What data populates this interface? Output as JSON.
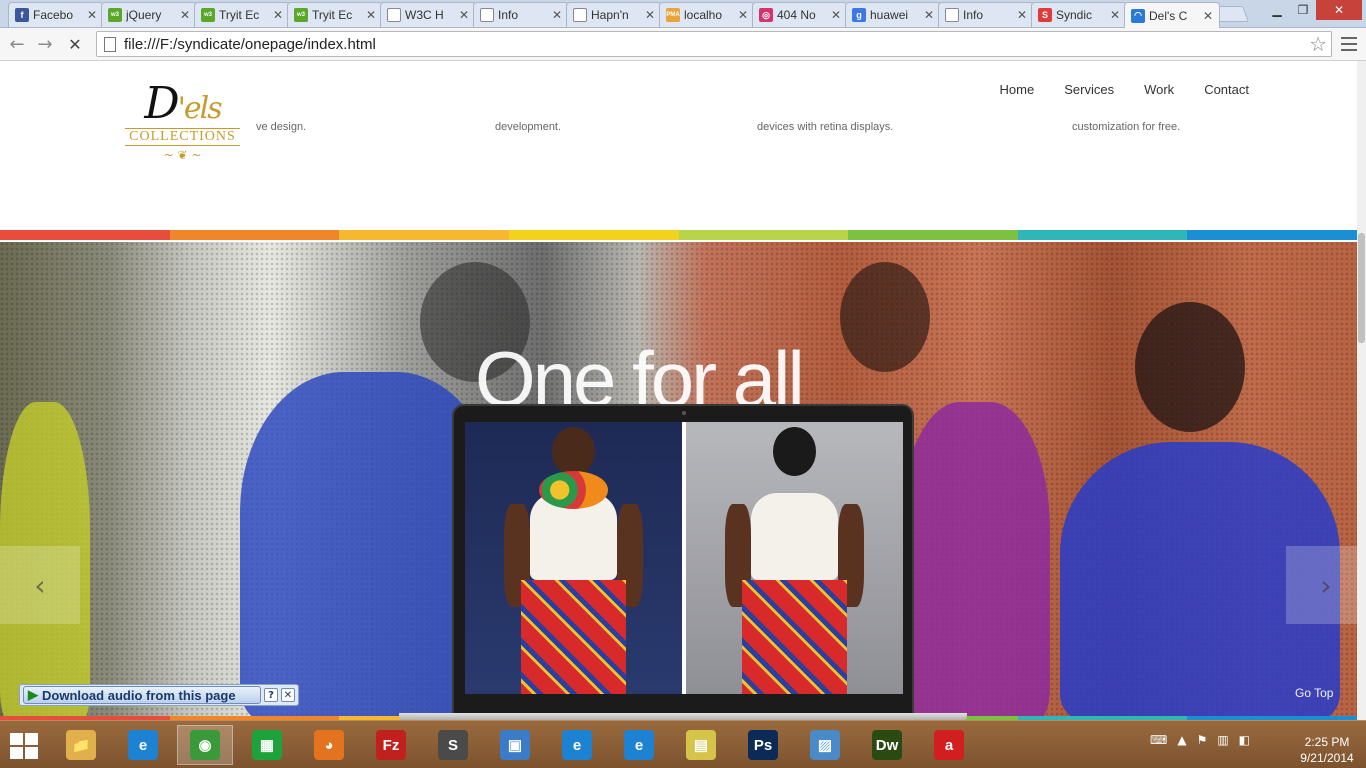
{
  "browser": {
    "tabs": [
      {
        "title": "Facebo",
        "favicon": "facebook-icon",
        "color": "#3b5998",
        "glyph": "f"
      },
      {
        "title": "jQuery",
        "favicon": "w3-icon",
        "color": "#5aa72a",
        "glyph": "w3"
      },
      {
        "title": "Tryit Ec",
        "favicon": "w3-icon",
        "color": "#5aa72a",
        "glyph": "w3"
      },
      {
        "title": "Tryit Ec",
        "favicon": "w3-icon",
        "color": "#5aa72a",
        "glyph": "w3"
      },
      {
        "title": "W3C H",
        "favicon": "page-icon",
        "color": "#ffffff",
        "glyph": ""
      },
      {
        "title": "Info",
        "favicon": "page-icon",
        "color": "#ffffff",
        "glyph": ""
      },
      {
        "title": "Hapn'n",
        "favicon": "page-icon",
        "color": "#ffffff",
        "glyph": ""
      },
      {
        "title": "localho",
        "favicon": "phpmyadmin-icon",
        "color": "#e8a33c",
        "glyph": "PMA"
      },
      {
        "title": "404 No",
        "favicon": "instagram-icon",
        "color": "#d6336c",
        "glyph": "◎"
      },
      {
        "title": "huawei",
        "favicon": "google-icon",
        "color": "#3b78e7",
        "glyph": "g"
      },
      {
        "title": "Info",
        "favicon": "page-icon",
        "color": "#ffffff",
        "glyph": ""
      },
      {
        "title": "Syndic",
        "favicon": "syndicate-icon",
        "color": "#e23b3b",
        "glyph": "S"
      },
      {
        "title": "Del's C",
        "favicon": "loading-icon",
        "color": "#2a7ad6",
        "glyph": "◠"
      }
    ],
    "url": "file:///F:/syndicate/onepage/index.html"
  },
  "site": {
    "logo": {
      "main": "D",
      "accent": "'els",
      "sub": "COLLECTIONS",
      "flourish": "~ ❦ ~"
    },
    "nav": [
      "Home",
      "Services",
      "Work",
      "Contact"
    ],
    "features": [
      "ve design.",
      "development.",
      "devices with retina displays.",
      "customization for free."
    ],
    "stripe_colors": [
      "#e74c3c",
      "#f0862a",
      "#f5b82e",
      "#f3d21e",
      "#b8d44a",
      "#7cc142",
      "#2fb6b8",
      "#1a8fd6"
    ],
    "hero_title": "One for all",
    "goto_top": "Go Top",
    "prev_arrow": "‹",
    "next_arrow": "›"
  },
  "extension_bar": {
    "label": "Download audio from this page",
    "help": "?",
    "close": "✕"
  },
  "taskbar": {
    "apps": [
      {
        "name": "file-explorer-icon",
        "label": "📁",
        "color": "#e0b04a",
        "active": false
      },
      {
        "name": "internet-explorer-icon",
        "label": "e",
        "color": "#1e82d2",
        "active": false
      },
      {
        "name": "chrome-icon",
        "label": "◉",
        "color": "#3a9a3a",
        "active": true
      },
      {
        "name": "store-icon",
        "label": "▦",
        "color": "#1ea23c",
        "active": false
      },
      {
        "name": "firefox-icon",
        "label": "◕",
        "color": "#e3731e",
        "active": false
      },
      {
        "name": "filezilla-icon",
        "label": "Fz",
        "color": "#c0201e",
        "active": false
      },
      {
        "name": "sublime-icon",
        "label": "S",
        "color": "#4a4a4a",
        "active": false
      },
      {
        "name": "remote-desktop-icon",
        "label": "▣",
        "color": "#3a7cc8",
        "active": false
      },
      {
        "name": "internet-explorer-icon-2",
        "label": "e",
        "color": "#1e82d2",
        "active": false
      },
      {
        "name": "internet-explorer-icon-3",
        "label": "e",
        "color": "#1e82d2",
        "active": false
      },
      {
        "name": "sticky-notes-icon",
        "label": "▤",
        "color": "#d6c44a",
        "active": false
      },
      {
        "name": "photoshop-icon",
        "label": "Ps",
        "color": "#0b2a55",
        "active": false
      },
      {
        "name": "photo-viewer-icon",
        "label": "▨",
        "color": "#4a8ac8",
        "active": false
      },
      {
        "name": "dreamweaver-icon",
        "label": "Dw",
        "color": "#2a4a12",
        "active": false
      },
      {
        "name": "airtel-icon",
        "label": "a",
        "color": "#d21e1e",
        "active": false
      }
    ],
    "time": "2:25 PM",
    "date": "9/21/2014"
  }
}
